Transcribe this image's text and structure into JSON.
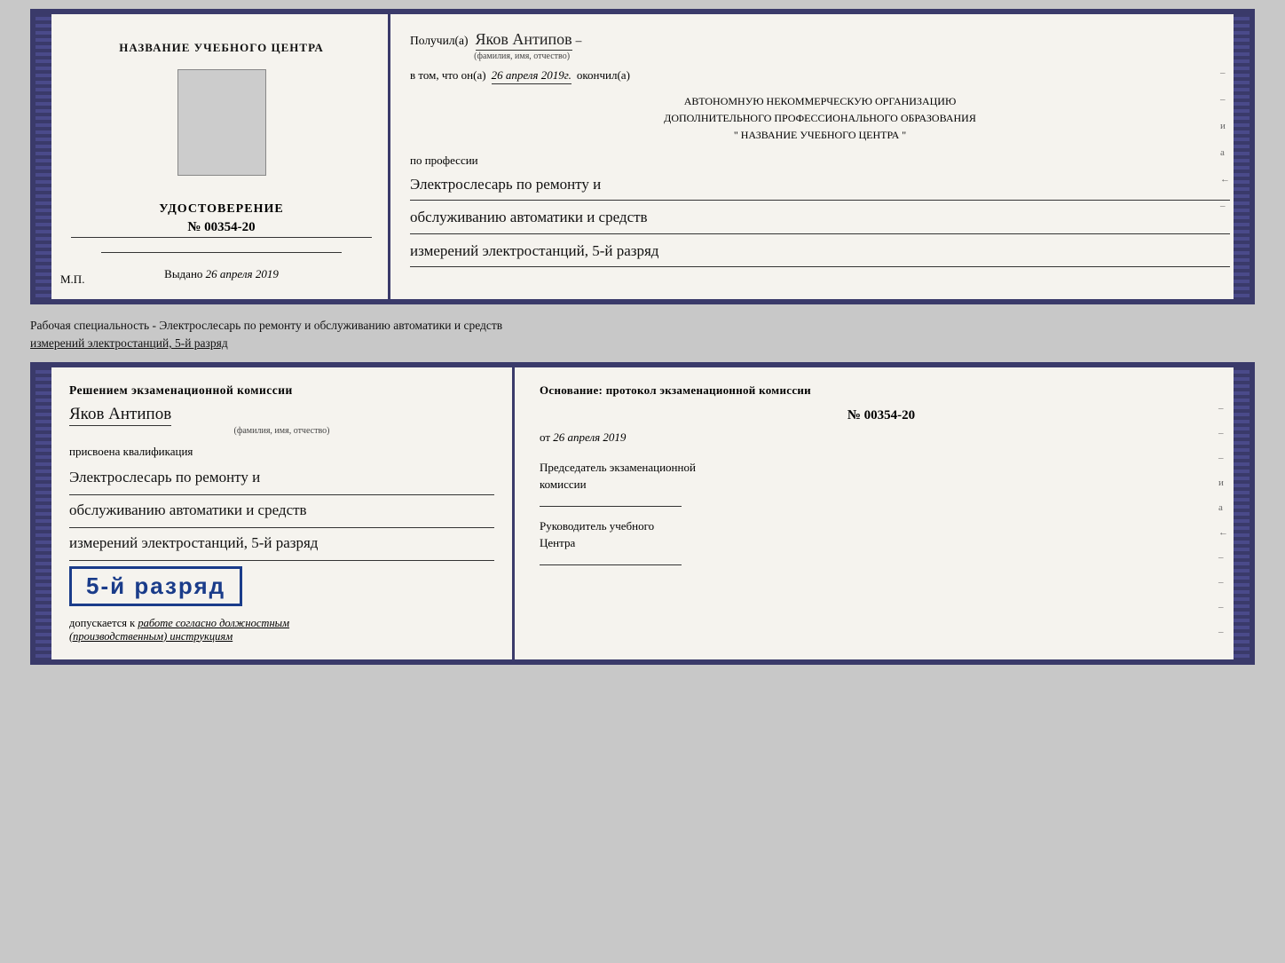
{
  "top_doc": {
    "left": {
      "title": "НАЗВАНИЕ УЧЕБНОГО ЦЕНТРА",
      "udostoverenie_label": "УДОСТОВЕРЕНИЕ",
      "number": "№ 00354-20",
      "vydano_label": "Выдано",
      "vydano_date": "26 апреля 2019",
      "mp": "М.П."
    },
    "right": {
      "poluchil": "Получил(а)",
      "name": "Яков Антипов",
      "fio_sub": "(фамилия, имя, отчество)",
      "dash": "–",
      "v_tom": "в том, что он(а)",
      "date_handwritten": "26 апреля 2019г.",
      "okonchil": "окончил(а)",
      "org_line1": "АВТОНОМНУЮ НЕКОММЕРЧЕСКУЮ ОРГАНИЗАЦИЮ",
      "org_line2": "ДОПОЛНИТЕЛЬНОГО ПРОФЕССИОНАЛЬНОГО ОБРАЗОВАНИЯ",
      "org_line3": "\"  НАЗВАНИЕ УЧЕБНОГО ЦЕНТРА  \"",
      "po_professii": "по профессии",
      "profession_line1": "Электрослесарь по ремонту и",
      "profession_line2": "обслуживанию автоматики и средств",
      "profession_line3": "измерений электростанций, 5-й разряд",
      "side_marks": [
        "-",
        "-",
        "и",
        "а",
        "←",
        "-"
      ]
    }
  },
  "middle_text": "Рабочая специальность - Электрослесарь по ремонту и обслуживанию автоматики и средств\nизмерений электростанций, 5-й разряд",
  "bottom_doc": {
    "left": {
      "resheniem": "Решением экзаменационной комиссии",
      "name": "Яков Антипов",
      "fio_sub": "(фамилия, имя, отчество)",
      "prisvoena": "присвоена квалификация",
      "qual_line1": "Электрослесарь по ремонту и",
      "qual_line2": "обслуживанию автоматики и средств",
      "qual_line3": "измерений электростанций, 5-й разряд",
      "razryad_badge": "5-й разряд",
      "dopuskaetsya_prefix": "допускается к",
      "dopuskaetsya_link": "работе согласно должностным",
      "dopuskaetsya_suffix": "(производственным) инструкциям"
    },
    "right": {
      "osnovanie": "Основание: протокол экзаменационной комиссии",
      "number": "№  00354-20",
      "ot_label": "от",
      "date": "26 апреля 2019",
      "predsedatel_label": "Председатель экзаменационной",
      "predsedatel_label2": "комиссии",
      "rukovoditel_label": "Руководитель учебного",
      "rukovoditel_label2": "Центра",
      "side_marks": [
        "-",
        "-",
        "-",
        "и",
        "а",
        "←",
        "-",
        "-",
        "-",
        "-"
      ]
    }
  }
}
